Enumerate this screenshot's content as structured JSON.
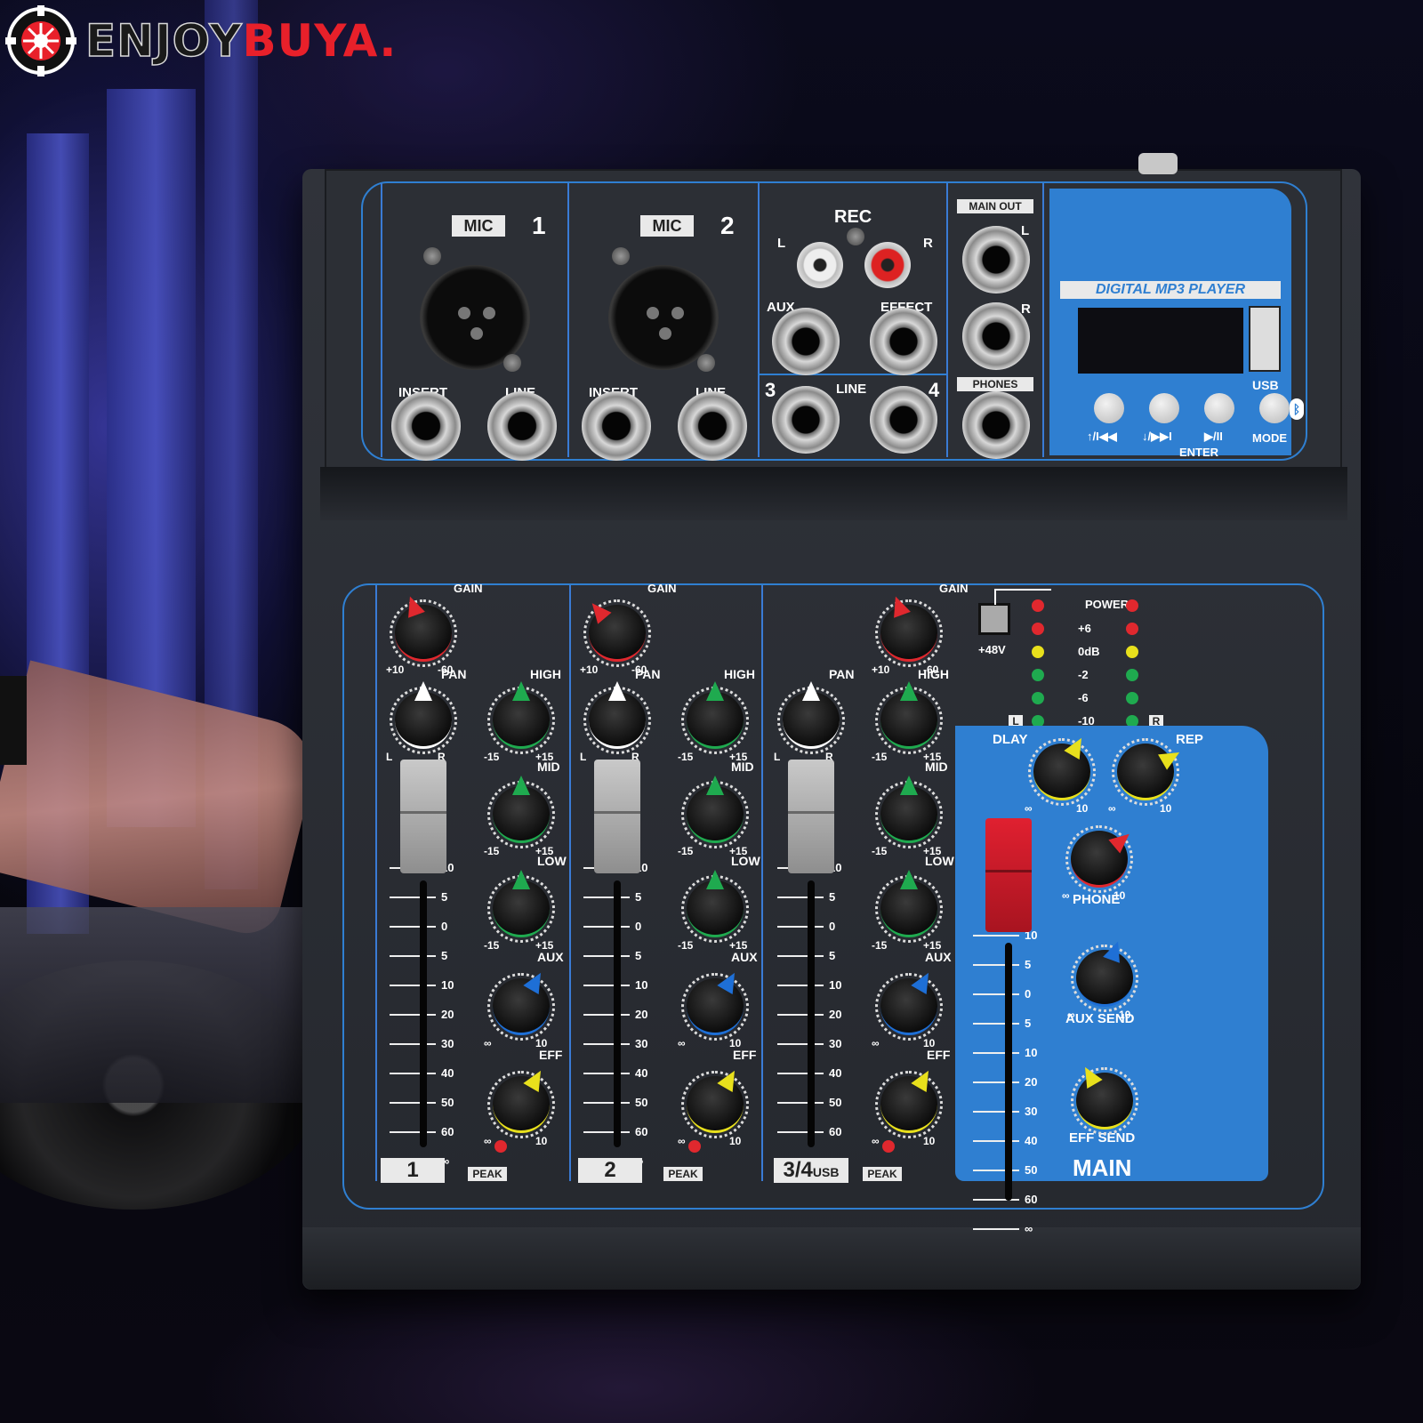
{
  "brand": {
    "enjoy": "ENJOY",
    "buya": "BUYA",
    "dot": "."
  },
  "top": {
    "mic1": {
      "tag": "MIC",
      "num": "1",
      "insert": "INSERT",
      "line": "LINE"
    },
    "mic2": {
      "tag": "MIC",
      "num": "2",
      "insert": "INSERT",
      "line": "LINE"
    },
    "rec": {
      "title": "REC",
      "l": "L",
      "r": "R",
      "aux": "AUX",
      "effect": "EFFECT"
    },
    "line34": {
      "n3": "3",
      "label": "LINE",
      "n4": "4"
    },
    "mainout": {
      "title": "MAIN OUT",
      "l": "L",
      "r": "R",
      "phones": "PHONES"
    },
    "mp3": {
      "title": "DIGITAL MP3 PLAYER",
      "usb": "USB",
      "b1": "↑/I◀◀",
      "b2": "↓/▶▶I",
      "b3": "▶/II",
      "enter": "ENTER",
      "b4": "MODE"
    }
  },
  "channels": [
    {
      "label": "1",
      "peak": "PEAK"
    },
    {
      "label": "2",
      "peak": "PEAK"
    },
    {
      "label": "3/4",
      "suffix": "USB",
      "peak": "PEAK"
    }
  ],
  "knob_labels": {
    "gain": "GAIN",
    "gain_min": "+10",
    "gain_max": "-60",
    "pan": "PAN",
    "pan_l": "L",
    "pan_r": "R",
    "high": "HIGH",
    "mid": "MID",
    "low": "LOW",
    "eq_min": "-15",
    "eq_max": "+15",
    "aux": "AUX",
    "eff": "EFF",
    "inf": "∞",
    "ten": "10"
  },
  "fader_scale": [
    "10",
    "5",
    "0",
    "5",
    "10",
    "20",
    "30",
    "40",
    "50",
    "60",
    "∞"
  ],
  "meter": {
    "power": "POWER",
    "levels": [
      "+6",
      "0dB",
      "-2",
      "-6",
      "-10"
    ],
    "l": "L",
    "r": "R",
    "phantom": "+48V"
  },
  "main": {
    "dlay": "DLAY",
    "rep": "REP",
    "phone": "PHONE",
    "aux_send": "AUX SEND",
    "eff_send": "EFF SEND",
    "title": "MAIN"
  },
  "colors": {
    "panel_blue": "#2f7fd1",
    "body": "#2a2d33",
    "red": "#e0282e",
    "green": "#1faa4f",
    "yellow": "#e8e01c",
    "blue": "#1e6fd6"
  }
}
